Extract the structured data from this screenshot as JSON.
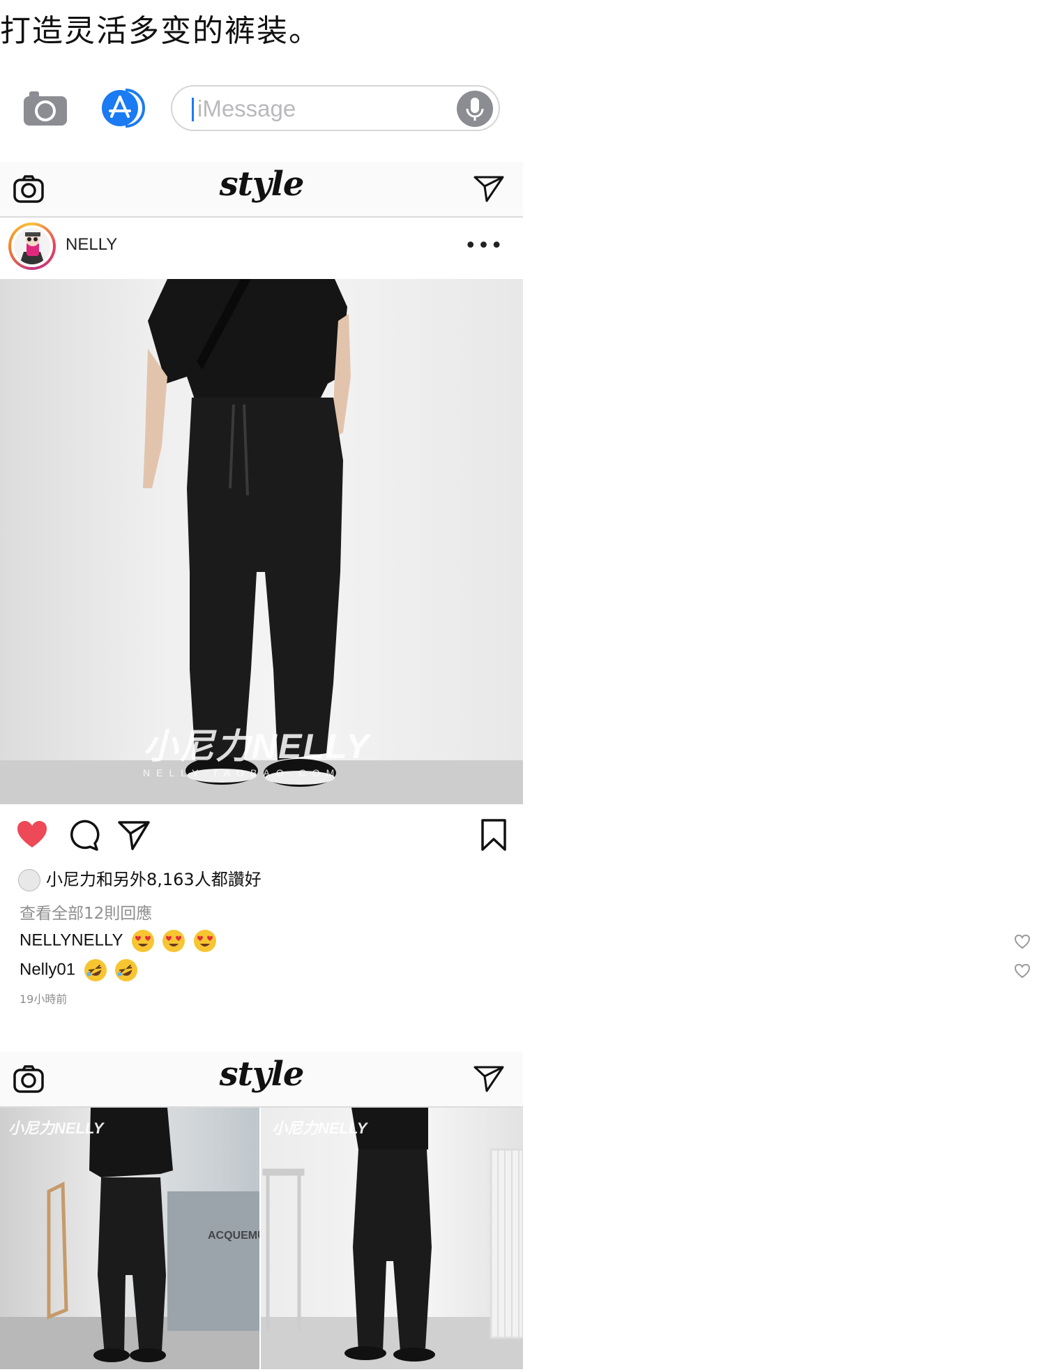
{
  "caption": "打造灵活多变的裤装。",
  "imessage": {
    "placeholder": "iMessage",
    "camera_icon": "camera-icon",
    "apps_icon": "app-store-icon",
    "mic_icon": "microphone-icon",
    "accent_color": "#1a7bf2"
  },
  "feed_header": {
    "logo": "style",
    "left_icon": "camera-icon",
    "right_icon": "direct-send-icon"
  },
  "post": {
    "username": "NELLY",
    "more_label": "•••",
    "photo_watermark": "小尼力NELLY",
    "photo_watermark_sub": "NELLY.TAOBAO.COM",
    "liked": true,
    "like_color": "#ed4956",
    "likes_text": "小尼力和另外8,163人都讚好",
    "view_all_comments": "查看全部12則回應",
    "comments": [
      {
        "user": "NELLYNELLY",
        "emojis": [
          "heart-eyes-emoji",
          "heart-eyes-emoji",
          "heart-eyes-emoji"
        ]
      },
      {
        "user": "Nelly01",
        "emojis": [
          "rofl-emoji",
          "rofl-emoji"
        ]
      }
    ],
    "time_ago": "19小時前"
  },
  "post2": {
    "photo_watermarks": [
      "小尼力NELLY",
      "小尼力NELLY"
    ],
    "background_sign": "ACQUEMUS"
  }
}
